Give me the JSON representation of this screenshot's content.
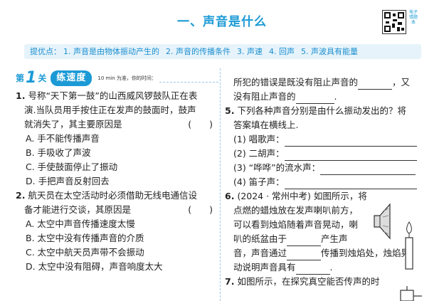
{
  "title": "一、声音是什么",
  "qr_label": "电子错题本",
  "hint": {
    "label": "提优点：",
    "points": [
      "1. 声音是由物体振动产生的",
      "2. 声音的传播条件",
      "3. 声速",
      "4. 回声",
      "5. 声波具有能量"
    ]
  },
  "level": {
    "di": "第",
    "num": "1",
    "guan": "关",
    "name": "练速度",
    "time_text": "10 min 为准，你的时间："
  },
  "left": {
    "q1": {
      "num": "1.",
      "stem": [
        "号称“天下第一鼓”的山西威风锣鼓队正在表",
        "演.当队员用手按住正在发声的鼓面时，鼓声",
        "就消失了，其主要原因是"
      ],
      "paren": "(　　)",
      "options": [
        "A. 手不能传播声音",
        "B. 手吸收了声波",
        "C. 手使鼓面停止了振动",
        "D. 手把声音反射回去"
      ]
    },
    "q2": {
      "num": "2.",
      "stem": [
        "航天员在太空活动时必须借助无线电通信设",
        "备才能进行交谈，其原因是"
      ],
      "paren": "(　　)",
      "options": [
        "A. 太空中声音传播速度太慢",
        "B. 太空中没有传播声音的介质",
        "C. 太空中航天员声带不会振动",
        "D. 太空中没有阻碍，声音响度太大"
      ]
    }
  },
  "right": {
    "q4_cont": {
      "a": "所犯的错误是既没有阻止声音的",
      "b": "，又",
      "c": "没有阻止声音的",
      "d": "."
    },
    "q5": {
      "num": "5.",
      "stem": [
        "下列各种声音分别是由什么振动发出的？将",
        "答案填在横线上."
      ],
      "items": [
        "(1) 唱歌声：",
        "(2) 二胡声：",
        "(3) “哗哗”的流水声：",
        "(4) 笛子声："
      ]
    },
    "q6": {
      "num": "6.",
      "lines": [
        "(2024 · 常州中考) 如图所示，将",
        "点燃的蜡烛放在发声喇叭前方，",
        "可以看到烛焰随着声音晃动，喇",
        "叭的纸盆由于",
        "产生声",
        "音，声音通过",
        "传播到烛焰处，烛焰晃",
        "动说明声音具有",
        "."
      ]
    },
    "q7": {
      "num": "7.",
      "text": "如图所示，在探究真空能否传声的时"
    }
  }
}
